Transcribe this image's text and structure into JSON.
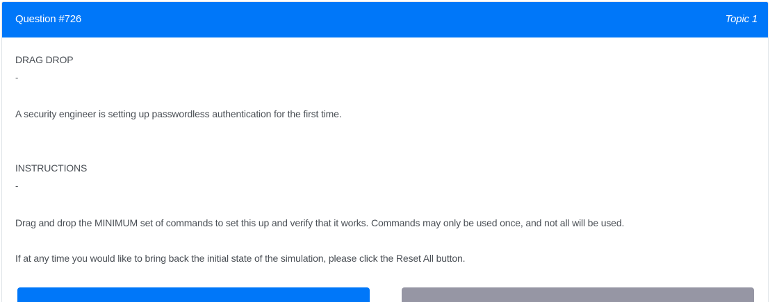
{
  "question": {
    "number": "Question #726",
    "topic": "Topic 1"
  },
  "content": {
    "section1_heading": "DRAG DROP",
    "section1_dash": "-",
    "intro": "A security engineer is setting up passwordless authentication for the first time.",
    "section2_heading": "INSTRUCTIONS",
    "section2_dash": "-",
    "instruction1": "Drag and drop the MINIMUM set of commands to set this up and verify that it works. Commands may only be used once, and not all will be used.",
    "instruction2": "If at any time you would like to bring back the initial state of the simulation, please click the Reset All button."
  },
  "colors": {
    "header_bg": "#0077f9",
    "primary_button": "#0077f9",
    "secondary_button": "#9696a4",
    "body_text": "#4a4f55"
  }
}
